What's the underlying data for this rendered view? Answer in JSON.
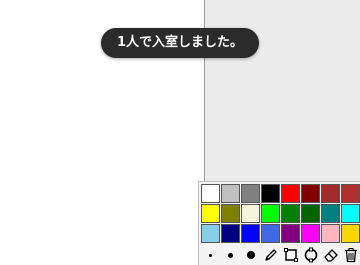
{
  "toast": {
    "message": "1人で入室しました。"
  },
  "palette": {
    "colors": [
      [
        "#ffffff",
        "#c0c0c0",
        "#808080",
        "#000000",
        "#ff0000",
        "#800000",
        "#a52a2a",
        "#b03030"
      ],
      [
        "#ffff00",
        "#808000",
        "#f5f5dc",
        "#00ff00",
        "#008000",
        "#006400",
        "#008080",
        "#00ffff"
      ],
      [
        "#87ceeb",
        "#000080",
        "#0000ff",
        "#4169e1",
        "#800080",
        "#ff00ff",
        "#ffb6c1",
        "#ffd700"
      ]
    ],
    "tools": [
      {
        "name": "pen-size-small",
        "icon": "small-dot-icon"
      },
      {
        "name": "pen-size-medium",
        "icon": "medium-dot-icon"
      },
      {
        "name": "pen-size-large",
        "icon": "large-dot-icon"
      },
      {
        "name": "pen-tool",
        "icon": "pencil-icon"
      },
      {
        "name": "rectangle-tool",
        "icon": "square-icon"
      },
      {
        "name": "circle-tool",
        "icon": "circle-icon"
      },
      {
        "name": "eraser-tool",
        "icon": "eraser-icon"
      },
      {
        "name": "clear-tool",
        "icon": "trash-icon"
      }
    ]
  }
}
